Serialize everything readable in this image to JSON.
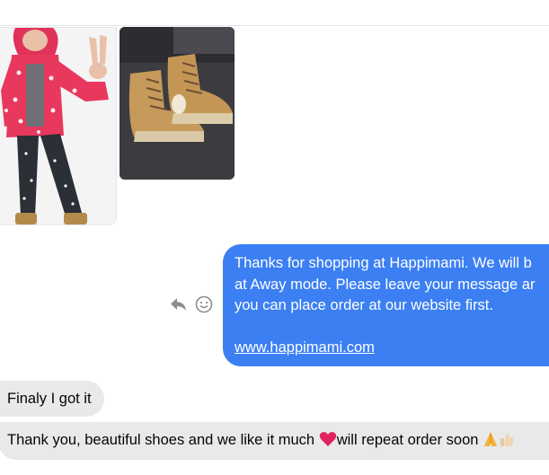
{
  "thread": {
    "images": [
      {
        "name": "child-photo",
        "alt": ""
      },
      {
        "name": "boots-photo",
        "alt": ""
      }
    ],
    "outgoing": {
      "lines": [
        "Thanks for shopping at Happimami. We will b",
        "at Away mode. Please leave your message ar",
        "you can place order at our website first."
      ],
      "link": "www.happimami.com"
    },
    "incoming": [
      {
        "text": "Finaly I got it"
      },
      {
        "text_before": "Thank you, beautiful shoes and we like it much ",
        "emoji_1": "heart-emoji",
        "text_after": "will repeat order soon ",
        "emoji_2": "folded-hands-emoji",
        "emoji_3": "thumbs-up-emoji"
      }
    ],
    "actions": {
      "reply_icon": "reply-icon",
      "react_icon": "smiley-icon"
    }
  },
  "colors": {
    "outgoing_bubble": "#3b7ff2",
    "incoming_bubble": "#e9e9eb",
    "icon_gray": "#8a8d91",
    "heart": "#e0245e"
  }
}
